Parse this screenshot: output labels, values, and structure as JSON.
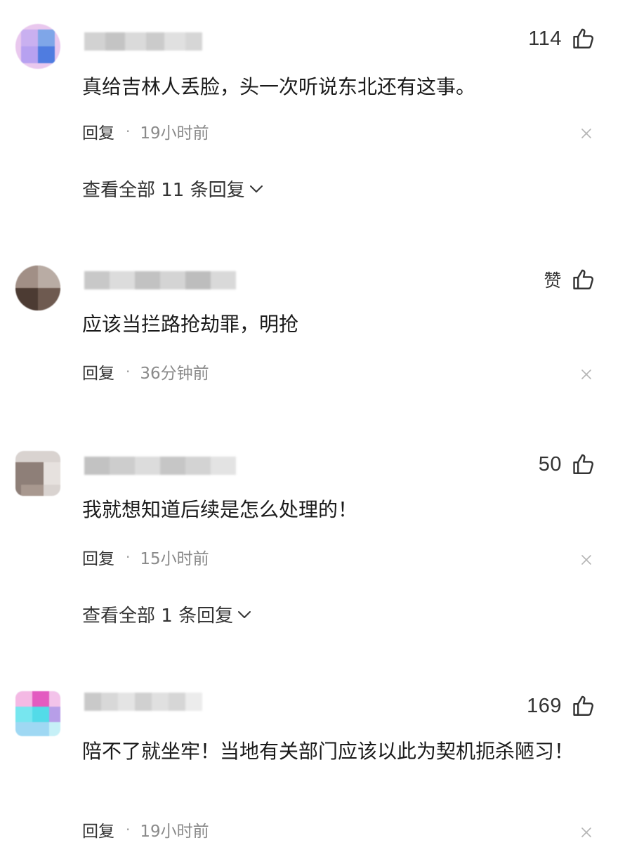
{
  "comments": [
    {
      "likes": "114",
      "text": "真给吉林人丢脸，头一次听说东北还有这事。",
      "reply_label": "回复",
      "separator": "·",
      "time": "19小时前",
      "view_all": "查看全部 11 条回复"
    },
    {
      "likes": "赞",
      "text": "应该当拦路抢劫罪，明抢",
      "reply_label": "回复",
      "separator": "·",
      "time": "36分钟前"
    },
    {
      "likes": "50",
      "text": "我就想知道后续是怎么处理的！",
      "reply_label": "回复",
      "separator": "·",
      "time": "15小时前",
      "view_all": "查看全部 1 条回复"
    },
    {
      "likes": "169",
      "text": "陪不了就坐牢！当地有关部门应该以此为契机扼杀陋习！",
      "reply_label": "回复",
      "separator": "·",
      "time": "19小时前"
    }
  ],
  "icons": {
    "like": "thumbs-up-icon",
    "close": "close-icon",
    "expand": "chevron-down-icon"
  },
  "colors": {
    "text": "#1a1a1a",
    "meta": "#8a8a8a",
    "icon": "#333333"
  }
}
